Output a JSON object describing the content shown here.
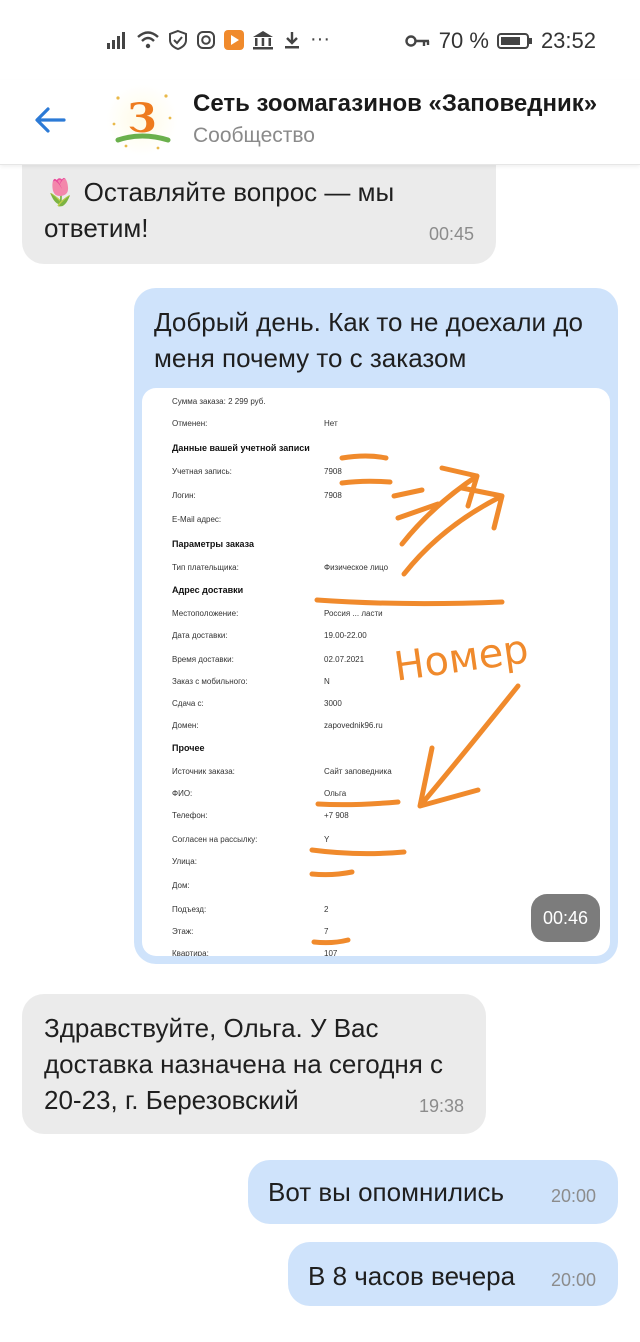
{
  "status_bar": {
    "battery_percent": "70 %",
    "time": "23:52",
    "icons": [
      "signal-icon",
      "wifi-icon",
      "shield-icon",
      "instagram-icon",
      "play-icon",
      "bank-icon",
      "download-icon",
      "more-dots-icon",
      "key-icon",
      "battery-icon"
    ]
  },
  "header": {
    "title": "Сеть зоомагазинов «Заповедник»",
    "subtitle": "Сообщество",
    "avatar_letter": "З"
  },
  "messages": [
    {
      "direction": "in",
      "emoji": "🌷",
      "text": "Оставляйте вопрос — мы ответим!",
      "time": "00:45"
    },
    {
      "direction": "out",
      "text": "Добрый день. Как то не доехали до меня почему то с заказом",
      "time": "00:46",
      "attachment": {
        "top_cut": "Сумма заказа:  2 299 руб.",
        "rows": [
          {
            "label": "Отменен:",
            "value": "Нет"
          },
          {
            "section": "Данные вашей учетной записи"
          },
          {
            "label": "Учетная запись:",
            "value": "7908"
          },
          {
            "label": "Логин:",
            "value": "7908"
          },
          {
            "label": "E-Mail адрес:",
            "value": ""
          },
          {
            "section": "Параметры заказа"
          },
          {
            "label": "Тип плательщика:",
            "value": "Физическое лицо"
          },
          {
            "section": "Адрес доставки"
          },
          {
            "label": "Местоположение:",
            "value": "Россия ... ласти"
          },
          {
            "label": "Дата доставки:",
            "value": "19.00-22.00"
          },
          {
            "label": "Время доставки:",
            "value": "02.07.2021"
          },
          {
            "label": "Заказ с мобильного:",
            "value": "N"
          },
          {
            "label": "Сдача с:",
            "value": "3000"
          },
          {
            "label": "Домен:",
            "value": "zapovednik96.ru"
          },
          {
            "section": "Прочее"
          },
          {
            "label": "Источник заказа:",
            "value": "Сайт заповедника"
          },
          {
            "label": "ФИО:",
            "value": "Ольга"
          },
          {
            "label": "Телефон:",
            "value": "+7 908"
          },
          {
            "label": "Согласен на рассылку:",
            "value": "Y"
          },
          {
            "label": "Улица:",
            "value": ""
          },
          {
            "label": "Дом:",
            "value": ""
          },
          {
            "label": "Подъезд:",
            "value": "2"
          },
          {
            "label": "Этаж:",
            "value": "7"
          },
          {
            "label": "Квартира:",
            "value": "107"
          }
        ],
        "handwritten_note": "Номер"
      }
    },
    {
      "direction": "in",
      "text": "Здравствуйте, Ольга. У Вас доставка назначена на сегодня с 20-23, г. Березовский",
      "time": "19:38"
    },
    {
      "direction": "out",
      "text": "Вот вы опомнились",
      "time": "20:00"
    },
    {
      "direction": "out",
      "text": "В 8 часов вечера",
      "time": "20:00"
    }
  ],
  "colors": {
    "incoming_bubble": "#ebebeb",
    "outgoing_bubble": "#cfe3fb",
    "accent": "#2c7ad6",
    "annotation_orange": "#f08a2c"
  }
}
